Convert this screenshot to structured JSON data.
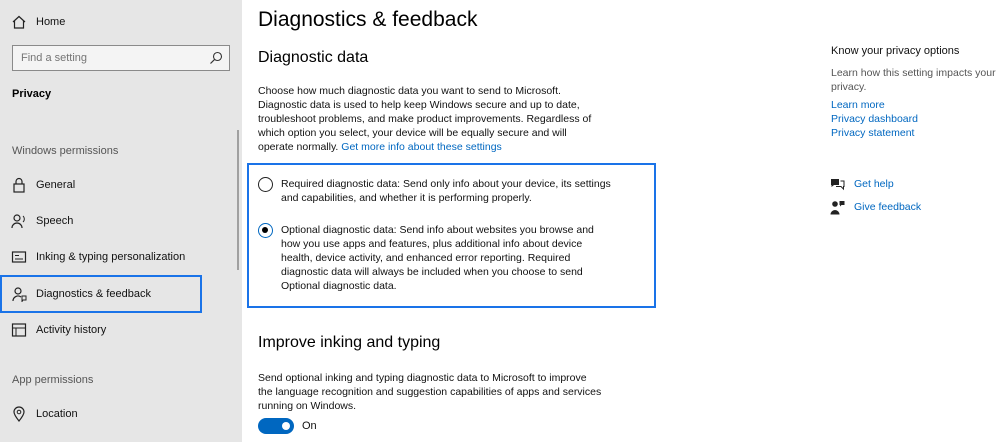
{
  "sidebar": {
    "home_label": "Home",
    "search_placeholder": "Find a setting",
    "section_title": "Privacy",
    "windows_permissions_label": "Windows permissions",
    "app_permissions_label": "App permissions",
    "items": [
      {
        "label": "General",
        "icon": "lock-icon"
      },
      {
        "label": "Speech",
        "icon": "speech-icon"
      },
      {
        "label": "Inking & typing personalization",
        "icon": "inking-icon"
      },
      {
        "label": "Diagnostics & feedback",
        "icon": "diagnostics-icon",
        "selected": true
      },
      {
        "label": "Activity history",
        "icon": "activity-icon"
      },
      {
        "label": "Location",
        "icon": "location-icon"
      }
    ]
  },
  "main": {
    "title": "Diagnostics & feedback",
    "diagnostic_heading": "Diagnostic data",
    "diagnostic_intro": "Choose how much diagnostic data you want to send to Microsoft. Diagnostic data is used to help keep Windows secure and up to date, troubleshoot problems, and make product improvements. Regardless of which option you select, your device will be equally secure and will operate normally.",
    "diagnostic_link": "Get more info about these settings",
    "options": [
      {
        "label": "Required diagnostic data: Send only info about your device, its settings and capabilities, and whether it is performing properly.",
        "selected": false
      },
      {
        "label": "Optional diagnostic data: Send info about websites you browse and how you use apps and features, plus additional info about device health, device activity, and enhanced error reporting. Required diagnostic data will always be included when you choose to send Optional diagnostic data.",
        "selected": true
      }
    ],
    "inking_heading": "Improve inking and typing",
    "inking_desc": "Send optional inking and typing diagnostic data to Microsoft to improve the language recognition and suggestion capabilities of apps and services running on Windows.",
    "inking_toggle_state": "On"
  },
  "right": {
    "privacy_title": "Know your privacy options",
    "privacy_desc": "Learn how this setting impacts your privacy.",
    "links": [
      "Learn more",
      "Privacy dashboard",
      "Privacy statement"
    ],
    "help": [
      {
        "label": "Get help",
        "icon": "help-chat-icon"
      },
      {
        "label": "Give feedback",
        "icon": "feedback-icon"
      }
    ]
  },
  "colors": {
    "accent": "#0067c0",
    "focus_outline": "#1a73e8",
    "sidebar_bg": "#e6e6e6"
  }
}
